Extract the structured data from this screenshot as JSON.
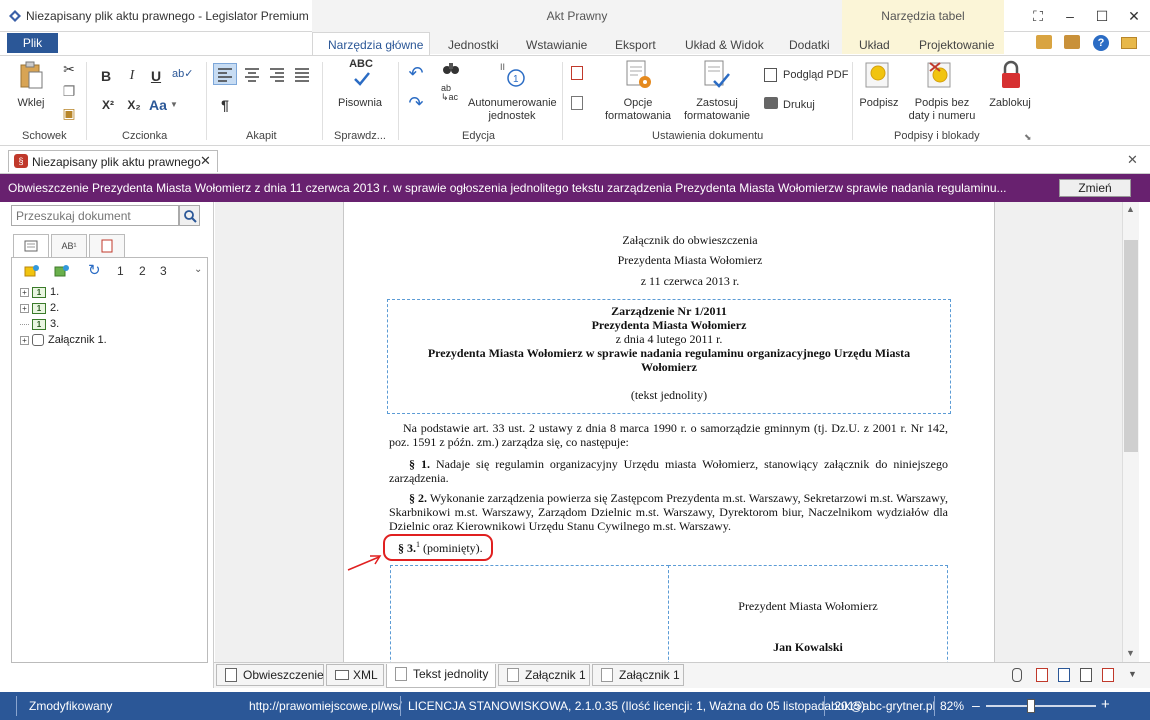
{
  "window": {
    "title": "Niezapisany plik aktu prawnego - Legislator Premium 201...",
    "ctx_akt": "Akt Prawny",
    "ctx_tabel": "Narzędzia tabel"
  },
  "tabs": {
    "plik": "Plik",
    "narzedzia_glowne": "Narzędzia główne",
    "jednostki": "Jednostki",
    "wstawianie": "Wstawianie",
    "eksport": "Eksport",
    "uklad_widok": "Układ & Widok",
    "dodatki": "Dodatki",
    "uklad": "Układ",
    "projektowanie": "Projektowanie"
  },
  "ribbon": {
    "wklej": "Wklej",
    "schowek": "Schowek",
    "czcionka": "Czcionka",
    "bold": "B",
    "italic": "I",
    "underline": "U",
    "superscript": "X²",
    "subscript": "X₂",
    "aa": "Aa",
    "akapit": "Akapit",
    "pilcrow": "¶",
    "pisownia": "Pisownia",
    "abc": "ABC",
    "sprawdz": "Sprawdz...",
    "autonumerowanie": "Autonumerowanie",
    "jednostek": "jednostek",
    "edycja": "Edycja",
    "opcje": "Opcje",
    "formatowania": "formatowania",
    "zastosuj": "Zastosuj",
    "formatowanie": "formatowanie",
    "podglad_pdf": "Podgląd PDF",
    "drukuj": "Drukuj",
    "ustawienia": "Ustawienia dokumentu",
    "podpisz": "Podpisz",
    "podpis_bez_1": "Podpis bez",
    "podpis_bez_2": "daty i numeru",
    "zablokuj": "Zablokuj",
    "podpisy": "Podpisy i blokady"
  },
  "doc_tab": {
    "label": "Niezapisany plik aktu prawnego"
  },
  "banner": {
    "text": "Obwieszczenie Prezydenta Miasta Wołomierz z dnia 11 czerwca 2013 r. w sprawie ogłoszenia jednolitego tekstu zarządzenia Prezydenta Miasta Wołomierzw sprawie nadania regulaminu...",
    "button": "Zmień"
  },
  "left_panel": {
    "search_placeholder": "Przeszukaj dokument",
    "ptab2": "AB¹",
    "levels": [
      "1",
      "2",
      "3"
    ],
    "tree": [
      {
        "label": "1.",
        "expandable": true
      },
      {
        "label": "2.",
        "expandable": true
      },
      {
        "label": "3.",
        "expandable": false
      },
      {
        "label": "Załącznik 1.",
        "expandable": true
      }
    ]
  },
  "document": {
    "header_lines": [
      "Załącznik do obwieszczenia",
      "Prezydenta Miasta Wołomierz",
      "z 11 czerwca 2013 r."
    ],
    "box_title": "Zarządzenie Nr 1/2011",
    "box_issuer": "Prezydenta Miasta Wołomierz",
    "box_date": "z dnia 4 lutego 2011 r.",
    "box_subject": "Prezydenta Miasta Wołomierz w sprawie nadania regulaminu organizacyjnego Urzędu Miasta Wołomierz",
    "box_note": "(tekst jednolity)",
    "preamble": "Na podstawie art. 33 ust. 2 ustawy z dnia 8 marca 1990 r. o samorządzie gminnym (tj. Dz.U. z 2001 r. Nr 142, poz. 1591 z późn. zm.) zarządza się, co następuje:",
    "p1_num": "§ 1.",
    "p1_text": "Nadaje się regulamin organizacyjny Urzędu miasta Wołomierz, stanowiący załącznik do niniejszego zarządzenia.",
    "p2_num": "§ 2.",
    "p2_text": "Wykonanie zarządzenia powierza się Zastępcom Prezydenta m.st. Warszawy, Sekretarzowi m.st. Warszawy, Skarbnikowi m.st. Warszawy, Zarządom Dzielnic m.st. Warszawy, Dyrektorom biur, Naczelnikom wydziałów dla Dzielnic oraz Kierownikowi Urzędu Stanu Cywilnego m.st. Warszawy.",
    "p3_num": "§ 3.",
    "p3_sup": "1",
    "p3_text": "(pominięty).",
    "sign_title": "Prezydent Miasta Wołomierz",
    "sign_name": "Jan Kowalski"
  },
  "bottom_tabs": [
    "Obwieszczenie",
    "XML",
    "Tekst jednolity",
    "Załącznik 1",
    "Załącznik 1"
  ],
  "status": {
    "modified": "Zmodyfikowany",
    "url": "http://prawomiejscowe.pl/ws/",
    "license": "LICENCJA STANOWISKOWA, 2.1.0.35 (Ilość licencji: 1, Ważna do 05 listopada 2015)",
    "email": "bok@abc-grytner.pl",
    "zoom": "82%",
    "zoom_level": 0.82
  },
  "colors": {
    "banner": "#68216f",
    "statusbar": "#2b5797",
    "highlight": "#e02020"
  }
}
